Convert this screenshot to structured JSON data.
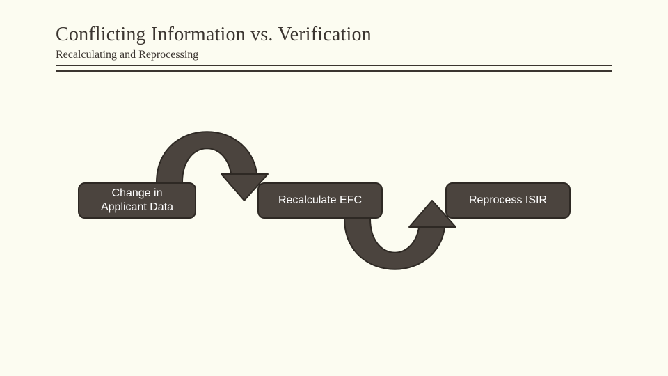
{
  "header": {
    "title": "Conflicting Information vs. Verification",
    "subtitle": "Recalculating and Reprocessing"
  },
  "diagram": {
    "nodes": [
      {
        "label": "Change in\nApplicant Data"
      },
      {
        "label": "Recalculate EFC"
      },
      {
        "label": "Reprocess ISIR"
      }
    ]
  },
  "colors": {
    "background": "#fcfcf1",
    "text_dark": "#3b3530",
    "node_fill": "#4b443e",
    "node_border": "#2e2924",
    "arrow_fill": "#4b443e",
    "arrow_edge": "#2e2924"
  }
}
